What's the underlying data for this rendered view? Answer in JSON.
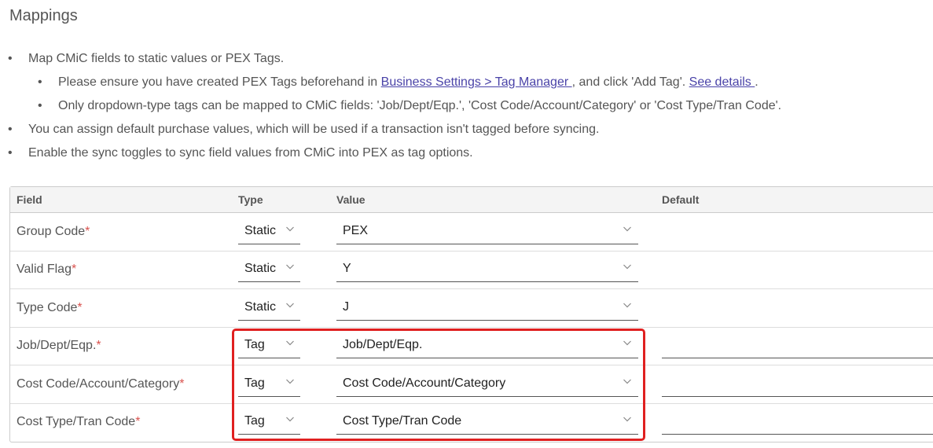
{
  "page": {
    "title": "Mappings"
  },
  "instructions": {
    "b1": "Map CMiC fields to static values or PEX Tags.",
    "b1a_pre": "Please ensure you have created PEX Tags beforehand in ",
    "b1a_link": "Business Settings > Tag Manager ",
    "b1a_mid": ", and click 'Add Tag'. ",
    "b1a_link2": "See details ",
    "b1a_post": ".",
    "b1b": "Only dropdown-type tags can be mapped to CMiC fields: 'Job/Dept/Eqp.', 'Cost Code/Account/Category' or 'Cost Type/Tran Code'.",
    "b2": "You can assign default purchase values, which will be used if a transaction isn't tagged before syncing.",
    "b3": "Enable the sync toggles to sync field values from CMiC into PEX as tag options."
  },
  "table": {
    "headers": {
      "field": "Field",
      "type": "Type",
      "value": "Value",
      "default": "Default"
    },
    "required_marker": "*",
    "rows": [
      {
        "field": "Group Code",
        "type": "Static",
        "value": "PEX"
      },
      {
        "field": "Valid Flag",
        "type": "Static",
        "value": "Y"
      },
      {
        "field": "Type Code",
        "type": "Static",
        "value": "J"
      },
      {
        "field": "Job/Dept/Eqp.",
        "type": "Tag",
        "value": "Job/Dept/Eqp."
      },
      {
        "field": "Cost Code/Account/Category",
        "type": "Tag",
        "value": "Cost Code/Account/Category"
      },
      {
        "field": "Cost Type/Tran Code",
        "type": "Tag",
        "value": "Cost Type/Tran Code"
      }
    ]
  },
  "icons": {
    "dropdown": "chevron-down-icon"
  },
  "colors": {
    "link": "#4a43a8",
    "required": "#d9534f",
    "highlight": "#e02020"
  }
}
